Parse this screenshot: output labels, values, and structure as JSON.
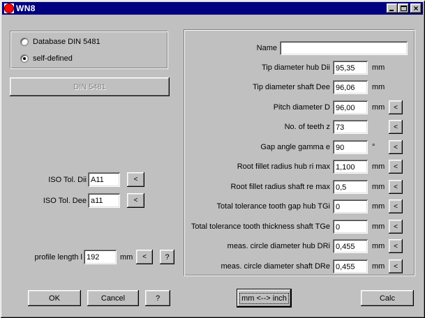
{
  "window": {
    "title": "WN8"
  },
  "controls": {
    "arrow_label": "<",
    "close_glyph": "×"
  },
  "left_panel": {
    "radios": [
      {
        "label": "Database DIN 5481",
        "selected": false
      },
      {
        "label": "self-defined",
        "selected": true
      }
    ],
    "din_button": "DIN 5481",
    "iso_rows": [
      {
        "label": "ISO Tol. Dii",
        "value": "A11"
      },
      {
        "label": "ISO Tol. Dee",
        "value": "a11"
      }
    ],
    "profile_row": {
      "label": "profile length l",
      "value": "192",
      "unit": "mm",
      "help_label": "?"
    }
  },
  "right_panel": {
    "rows": [
      {
        "label": "Name",
        "value": "",
        "unit": "",
        "arrow": false,
        "wide": true
      },
      {
        "label": "Tip diameter hub Dii",
        "value": "95,35",
        "unit": "mm",
        "arrow": false
      },
      {
        "label": "Tip diameter shaft Dee",
        "value": "96,06",
        "unit": "mm",
        "arrow": false
      },
      {
        "label": "Pitch diameter D",
        "value": "96,00",
        "unit": "mm",
        "arrow": true
      },
      {
        "label": "No. of teeth z",
        "value": "73",
        "unit": "",
        "arrow": true
      },
      {
        "label": "Gap angle gamma e",
        "value": "90",
        "unit": "°",
        "arrow": true
      },
      {
        "label": "Root fillet radius hub ri max",
        "value": "1,100",
        "unit": "mm",
        "arrow": true
      },
      {
        "label": "Root fillet radius shaft re max",
        "value": "0,5",
        "unit": "mm",
        "arrow": true
      },
      {
        "label": "Total tolerance tooth gap hub TGi",
        "value": "0",
        "unit": "mm",
        "arrow": true
      },
      {
        "label": "Total tolerance tooth thickness shaft TGe",
        "value": "0",
        "unit": "mm",
        "arrow": true
      },
      {
        "label": "meas. circle diameter hub DRi",
        "value": "0,455",
        "unit": "mm",
        "arrow": true
      },
      {
        "label": "meas. circle diameter shaft DRe",
        "value": "0,455",
        "unit": "mm",
        "arrow": true
      }
    ]
  },
  "bottom_bar": {
    "ok": "OK",
    "cancel": "Cancel",
    "help": "?",
    "mm_inch": "mm <--> inch",
    "calc": "Calc"
  },
  "colors": {
    "titlebar": "#000080",
    "background": "#c0c0c0",
    "icon_red": "#ff0000"
  }
}
